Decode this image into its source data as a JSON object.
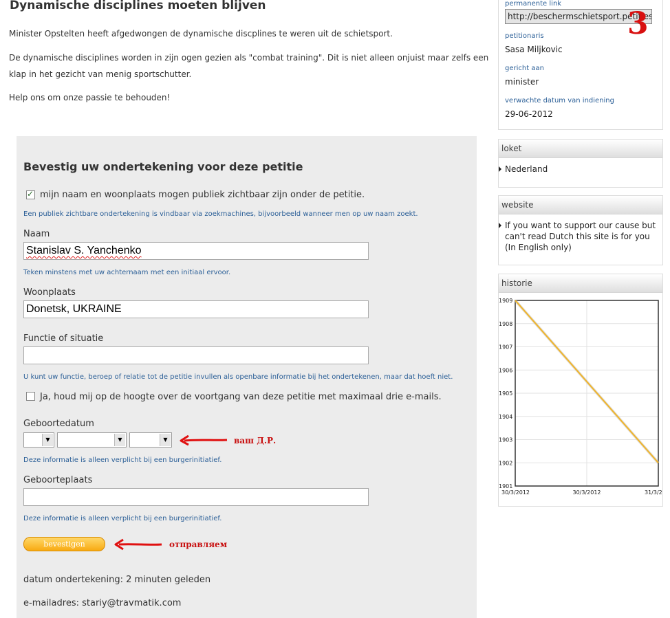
{
  "intro": {
    "title": "Dynamische disciplines moeten blijven",
    "paragraphs": [
      "Minister Opstelten heeft afgedwongen de dynamische discplines te weren uit de schietsport.",
      "De dynamische disciplines worden in zijn ogen gezien als \"combat training\". Dit is niet alleen onjuist maar zelfs een klap in het gezicht van menig sportschutter.",
      "Help ons om onze passie te behouden!"
    ]
  },
  "form": {
    "title": "Bevestig uw ondertekening voor deze petitie",
    "public_checkbox": {
      "label": "mijn naam en woonplaats mogen publiek zichtbaar zijn onder de petitie.",
      "checked": true
    },
    "public_hint": "Een publiek zichtbare ondertekening is vindbaar via zoekmachines, bijvoorbeeld wanneer men op uw naam zoekt.",
    "name_label": "Naam",
    "name_value": "Stanislav S. Yanchenko",
    "name_hint": "Teken minstens met uw achternaam met een initiaal ervoor.",
    "city_label": "Woonplaats",
    "city_value": "Donetsk, UKRAINE",
    "function_label": "Functie of situatie",
    "function_value": "",
    "function_hint": "U kunt uw functie, beroep of relatie tot de petitie invullen als openbare informatie bij het ondertekenen, maar dat hoeft niet.",
    "updates_checkbox": {
      "label": "Ja, houd mij op de hoogte over de voortgang van deze petitie met maximaal drie e-mails.",
      "checked": false
    },
    "birthdate_label": "Geboortedatum",
    "birthdate_hint": "Deze informatie is alleen verplicht bij een burgerinitiatief.",
    "birthplace_label": "Geboorteplaats",
    "birthplace_value": "",
    "birthplace_hint": "Deze informatie is alleen verplicht bij een burgerinitiatief.",
    "submit_label": "bevestigen",
    "signed_line": "datum ondertekening: 2 minuten geleden",
    "email_line": "e-mailadres: stariy@travmatik.com"
  },
  "annotations": {
    "birthdate_note": "ваш Д.Р.",
    "submit_note": "отправляем",
    "step_number": "3",
    "color": "#c81010"
  },
  "sidebar": {
    "permalink_label": "permanente link",
    "permalink_value": "http://beschermschietsport.petities.nl",
    "petitioner_label": "petitionaris",
    "petitioner_value": "Sasa Miljkovic",
    "addressed_label": "gericht aan",
    "addressed_value": "minister",
    "date_label": "verwachte datum van indiening",
    "date_value": "29-06-2012",
    "loket_title": "loket",
    "loket_item": "Nederland",
    "website_title": "website",
    "website_item": "If you want to support our cause but can't read Dutch this site is for you (In English only)",
    "history_title": "historie"
  },
  "chart_data": {
    "type": "line",
    "title": "",
    "xlabel": "",
    "ylabel": "",
    "x_ticks": [
      "30/3/2012",
      "30/3/2012",
      "31/3/2"
    ],
    "y_ticks": [
      "1909",
      "1908",
      "1907",
      "1906",
      "1905",
      "1904",
      "1903",
      "1902",
      "1901"
    ],
    "ylim": [
      1901,
      1909
    ],
    "series": [
      {
        "values": [
          1909,
          1902
        ],
        "color": "#f0b429"
      }
    ],
    "grid": true
  }
}
